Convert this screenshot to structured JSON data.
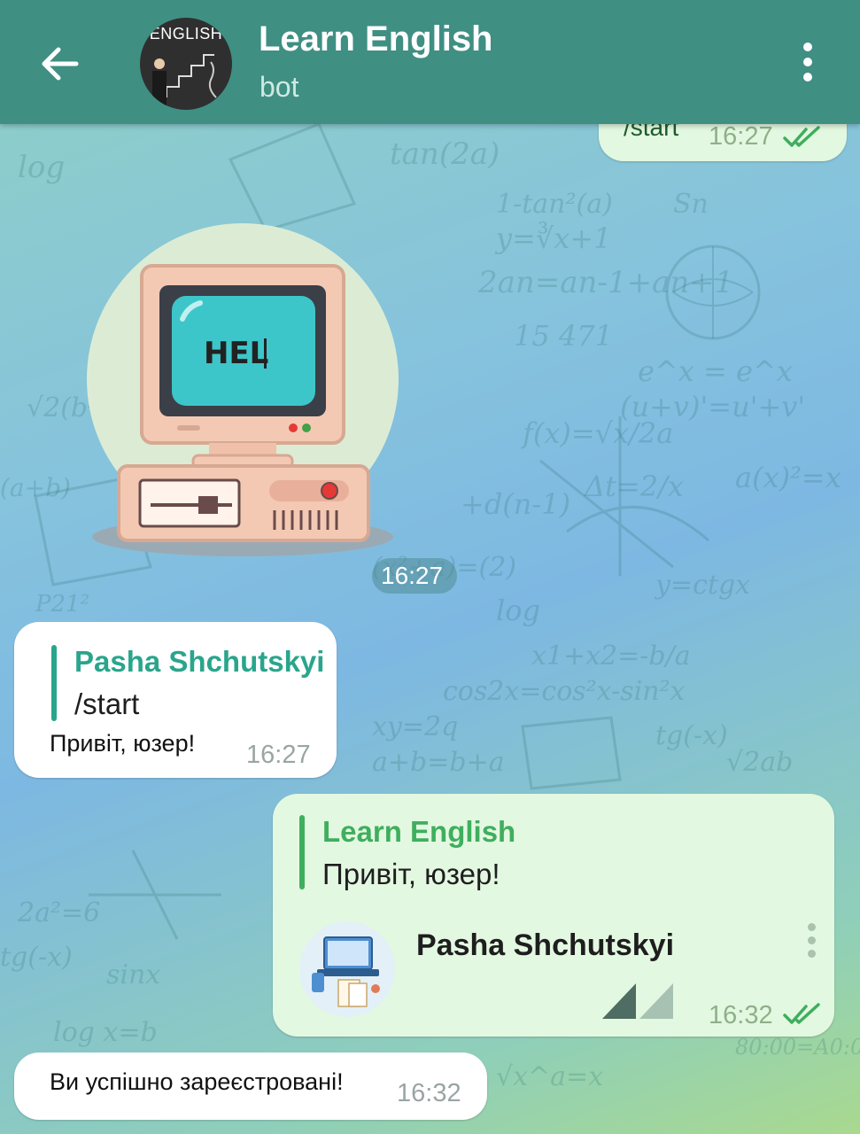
{
  "header": {
    "title": "Learn English",
    "subtitle": "bot",
    "avatar_text": "ENGLISH"
  },
  "messages": {
    "start_msg": {
      "text": "/start",
      "time": "16:27"
    },
    "sticker": {
      "screen_text": "HEL",
      "time": "16:27"
    },
    "reply1": {
      "quote_name": "Pasha Shchutskyi",
      "quote_text": "/start",
      "text": "Привіт, юзер!",
      "time": "16:27"
    },
    "reply2": {
      "quote_name": "Learn English",
      "quote_text": "Привіт, юзер!",
      "contact_name": "Pasha Shchutskyi",
      "time": "16:32"
    },
    "registered": {
      "text": "Ви успішно зареєстровані!",
      "time": "16:32"
    }
  },
  "colors": {
    "header_bg": "#3f8f83",
    "incoming_bubble": "#ffffff",
    "outgoing_bubble": "#e3f8e1",
    "quote_incoming": "#2aa58c",
    "quote_outgoing": "#3fae5e",
    "read_ticks": "#3fae5e"
  },
  "icons": {
    "back": "back-arrow-icon",
    "menu": "more-vertical-icon",
    "read": "double-check-icon",
    "contact_menu": "more-vertical-icon"
  }
}
